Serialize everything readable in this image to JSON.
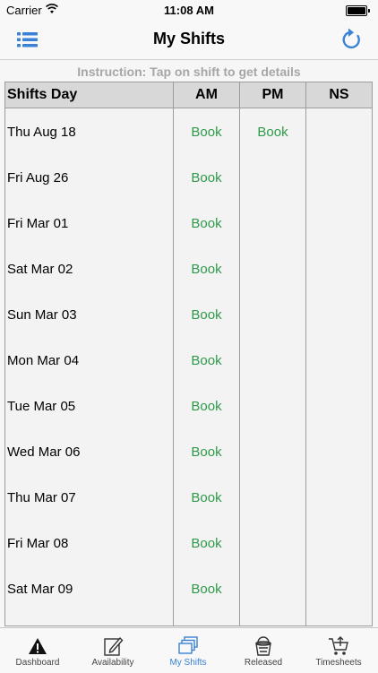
{
  "status_bar": {
    "carrier": "Carrier",
    "time": "11:08 AM"
  },
  "nav": {
    "title": "My Shifts",
    "menu_icon": "list-icon",
    "refresh_icon": "refresh-icon"
  },
  "instruction": "Instruction: Tap on shift to get details",
  "table": {
    "headers": [
      "Shifts Day",
      "AM",
      "PM",
      "NS"
    ],
    "rows": [
      {
        "day": "Thu Aug 18",
        "am": "Book",
        "pm": "Book",
        "ns": ""
      },
      {
        "day": "Fri Aug 26",
        "am": "Book",
        "pm": "",
        "ns": ""
      },
      {
        "day": "Fri Mar 01",
        "am": "Book",
        "pm": "",
        "ns": ""
      },
      {
        "day": "Sat Mar 02",
        "am": "Book",
        "pm": "",
        "ns": ""
      },
      {
        "day": "Sun Mar 03",
        "am": "Book",
        "pm": "",
        "ns": ""
      },
      {
        "day": "Mon Mar 04",
        "am": "Book",
        "pm": "",
        "ns": ""
      },
      {
        "day": "Tue Mar 05",
        "am": "Book",
        "pm": "",
        "ns": ""
      },
      {
        "day": "Wed Mar 06",
        "am": "Book",
        "pm": "",
        "ns": ""
      },
      {
        "day": "Thu Mar 07",
        "am": "Book",
        "pm": "",
        "ns": ""
      },
      {
        "day": "Fri Mar 08",
        "am": "Book",
        "pm": "",
        "ns": ""
      },
      {
        "day": "Sat Mar 09",
        "am": "Book",
        "pm": "",
        "ns": ""
      }
    ]
  },
  "tabs": [
    {
      "label": "Dashboard",
      "icon": "warning-icon",
      "active": false
    },
    {
      "label": "Availability",
      "icon": "edit-icon",
      "active": false
    },
    {
      "label": "My Shifts",
      "icon": "stack-icon",
      "active": true
    },
    {
      "label": "Released",
      "icon": "bucket-icon",
      "active": false
    },
    {
      "label": "Timesheets",
      "icon": "cart-icon",
      "active": false
    }
  ],
  "colors": {
    "accent": "#3a82d6",
    "book": "#2e9a4a",
    "instruction": "#a6a6a6",
    "header_bg": "#d8d8d8"
  }
}
